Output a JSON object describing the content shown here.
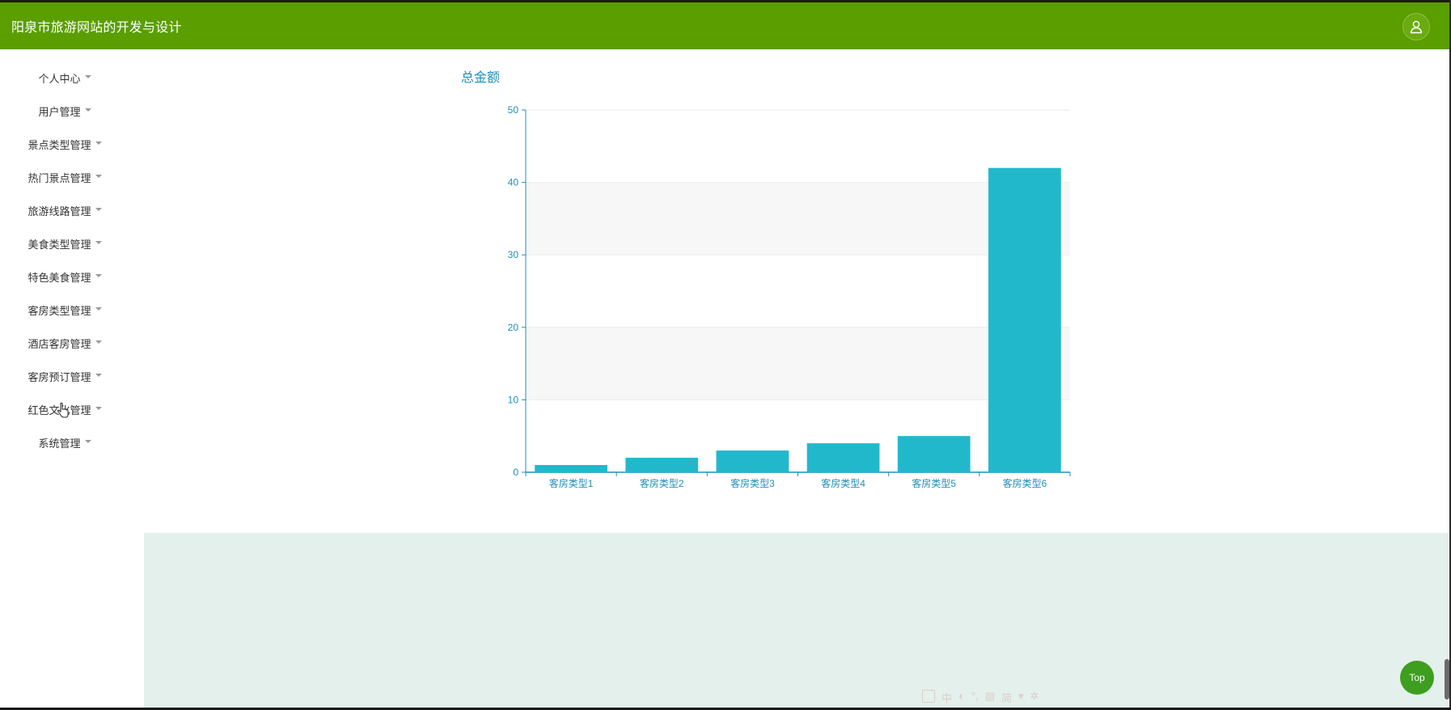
{
  "app": {
    "title": "阳泉市旅游网站的开发与设计"
  },
  "header": {
    "user_icon": "user-icon"
  },
  "sidebar": {
    "items": [
      {
        "label": "个人中心"
      },
      {
        "label": "用户管理"
      },
      {
        "label": "景点类型管理"
      },
      {
        "label": "热门景点管理"
      },
      {
        "label": "旅游线路管理"
      },
      {
        "label": "美食类型管理"
      },
      {
        "label": "特色美食管理"
      },
      {
        "label": "客房类型管理"
      },
      {
        "label": "酒店客房管理"
      },
      {
        "label": "客房预订管理"
      },
      {
        "label": "红色文化管理"
      },
      {
        "label": "系统管理"
      }
    ]
  },
  "colors": {
    "header_bg": "#5a9e00",
    "bar": "#22b8cc",
    "axis": "#1f8fb8",
    "footer_band": "#e4f0ec",
    "top_button": "#3d9e1f"
  },
  "chart_data": {
    "type": "bar",
    "title": "总金额",
    "categories": [
      "客房类型1",
      "客房类型2",
      "客房类型3",
      "客房类型4",
      "客房类型5",
      "客房类型6"
    ],
    "values": [
      1,
      2,
      3,
      4,
      5,
      42
    ],
    "ylim": [
      0,
      50
    ],
    "yticks": [
      0,
      10,
      20,
      30,
      40,
      50
    ],
    "xlabel": "",
    "ylabel": "",
    "grid": true,
    "legend": "none"
  },
  "ime": {
    "icons": [
      "中",
      "简"
    ]
  },
  "top_button": {
    "label": "Top"
  }
}
